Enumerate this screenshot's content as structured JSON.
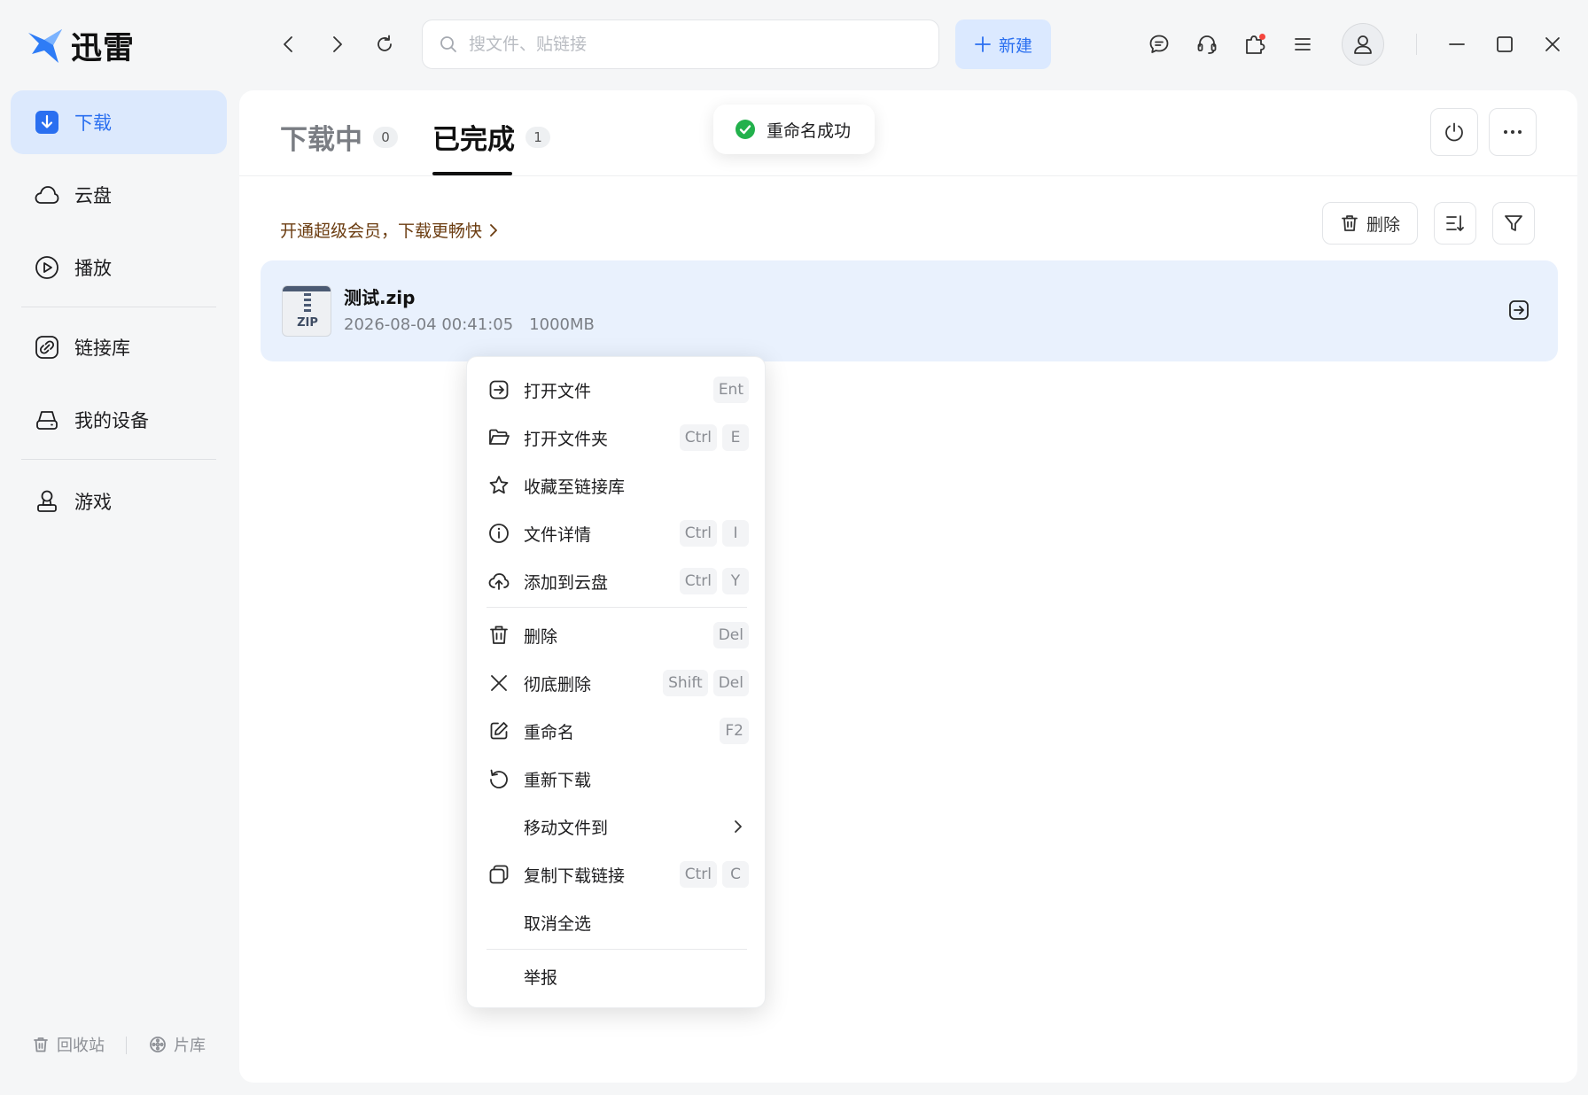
{
  "app": {
    "title": "迅雷"
  },
  "search": {
    "placeholder": "搜文件、贴链接"
  },
  "toolbar": {
    "new_label": "新建"
  },
  "sidebar": {
    "items": [
      {
        "label": "下载",
        "icon": "download-icon"
      },
      {
        "label": "云盘",
        "icon": "cloud-icon"
      },
      {
        "label": "播放",
        "icon": "play-icon"
      },
      {
        "label": "链接库",
        "icon": "link-icon"
      },
      {
        "label": "我的设备",
        "icon": "device-icon"
      },
      {
        "label": "游戏",
        "icon": "game-icon"
      }
    ],
    "bottom": [
      {
        "label": "回收站",
        "icon": "trash-icon"
      },
      {
        "label": "片库",
        "icon": "film-icon"
      }
    ]
  },
  "tabs": [
    {
      "label": "下载中",
      "count": "0"
    },
    {
      "label": "已完成",
      "count": "1"
    }
  ],
  "toast": {
    "text": "重命名成功",
    "color": "#22b14c"
  },
  "promo": {
    "text": "开通超级会员，下载更畅快"
  },
  "actions": {
    "delete_label": "删除"
  },
  "file": {
    "name": "测试.zip",
    "date": "2026-08-04 00:41:05",
    "size": "1000MB",
    "type_label": "ZIP"
  },
  "context_menu": {
    "items": [
      {
        "label": "打开文件",
        "keys": [
          "Ent"
        ]
      },
      {
        "label": "打开文件夹",
        "keys": [
          "Ctrl",
          "E"
        ]
      },
      {
        "label": "收藏至链接库",
        "keys": []
      },
      {
        "label": "文件详情",
        "keys": [
          "Ctrl",
          "I"
        ]
      },
      {
        "label": "添加到云盘",
        "keys": [
          "Ctrl",
          "Y"
        ]
      },
      {
        "label": "删除",
        "keys": [
          "Del"
        ]
      },
      {
        "label": "彻底删除",
        "keys": [
          "Shift",
          "Del"
        ]
      },
      {
        "label": "重命名",
        "keys": [
          "F2"
        ]
      },
      {
        "label": "重新下载",
        "keys": []
      },
      {
        "label": "移动文件到",
        "keys": []
      },
      {
        "label": "复制下载链接",
        "keys": [
          "Ctrl",
          "C"
        ]
      },
      {
        "label": "取消全选",
        "keys": []
      },
      {
        "label": "举报",
        "keys": []
      }
    ]
  },
  "colors": {
    "accent": "#2a6ff0",
    "active_bg": "#dce9fd",
    "row_bg": "#e9f1fd"
  }
}
